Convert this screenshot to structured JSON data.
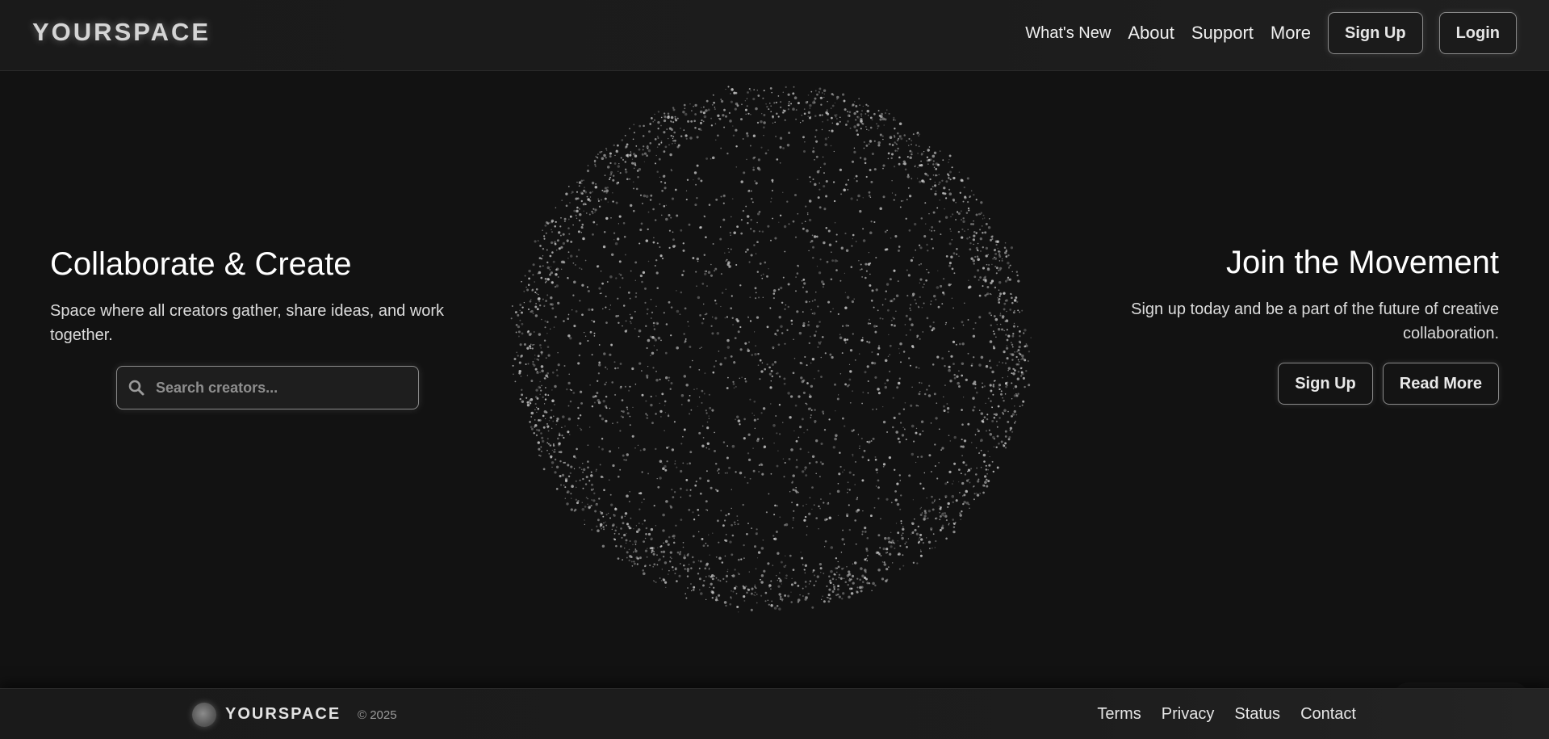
{
  "brand": {
    "name": "YOURSPACE"
  },
  "nav": {
    "links": [
      "What's New",
      "About",
      "Support",
      "More"
    ],
    "signup_label": "Sign Up",
    "login_label": "Login"
  },
  "hero_left": {
    "title": "Collaborate & Create",
    "description": "Space where all creators gather, share ideas, and work together.",
    "search": {
      "placeholder": "Search creators...",
      "value": ""
    }
  },
  "hero_right": {
    "title": "Join the Movement",
    "description": "Sign up today and be a part of the future of creative collaboration.",
    "primary_label": "Sign Up",
    "secondary_label": "Read More"
  },
  "footer": {
    "brand": "YOURSPACE",
    "copyright": "© 2025",
    "links": [
      "Terms",
      "Privacy",
      "Status",
      "Contact"
    ]
  },
  "colors": {
    "background": "#121212",
    "header_bg": "#1a1a1a",
    "particle": "#d0d0d0",
    "border": "#8a8a8a"
  }
}
